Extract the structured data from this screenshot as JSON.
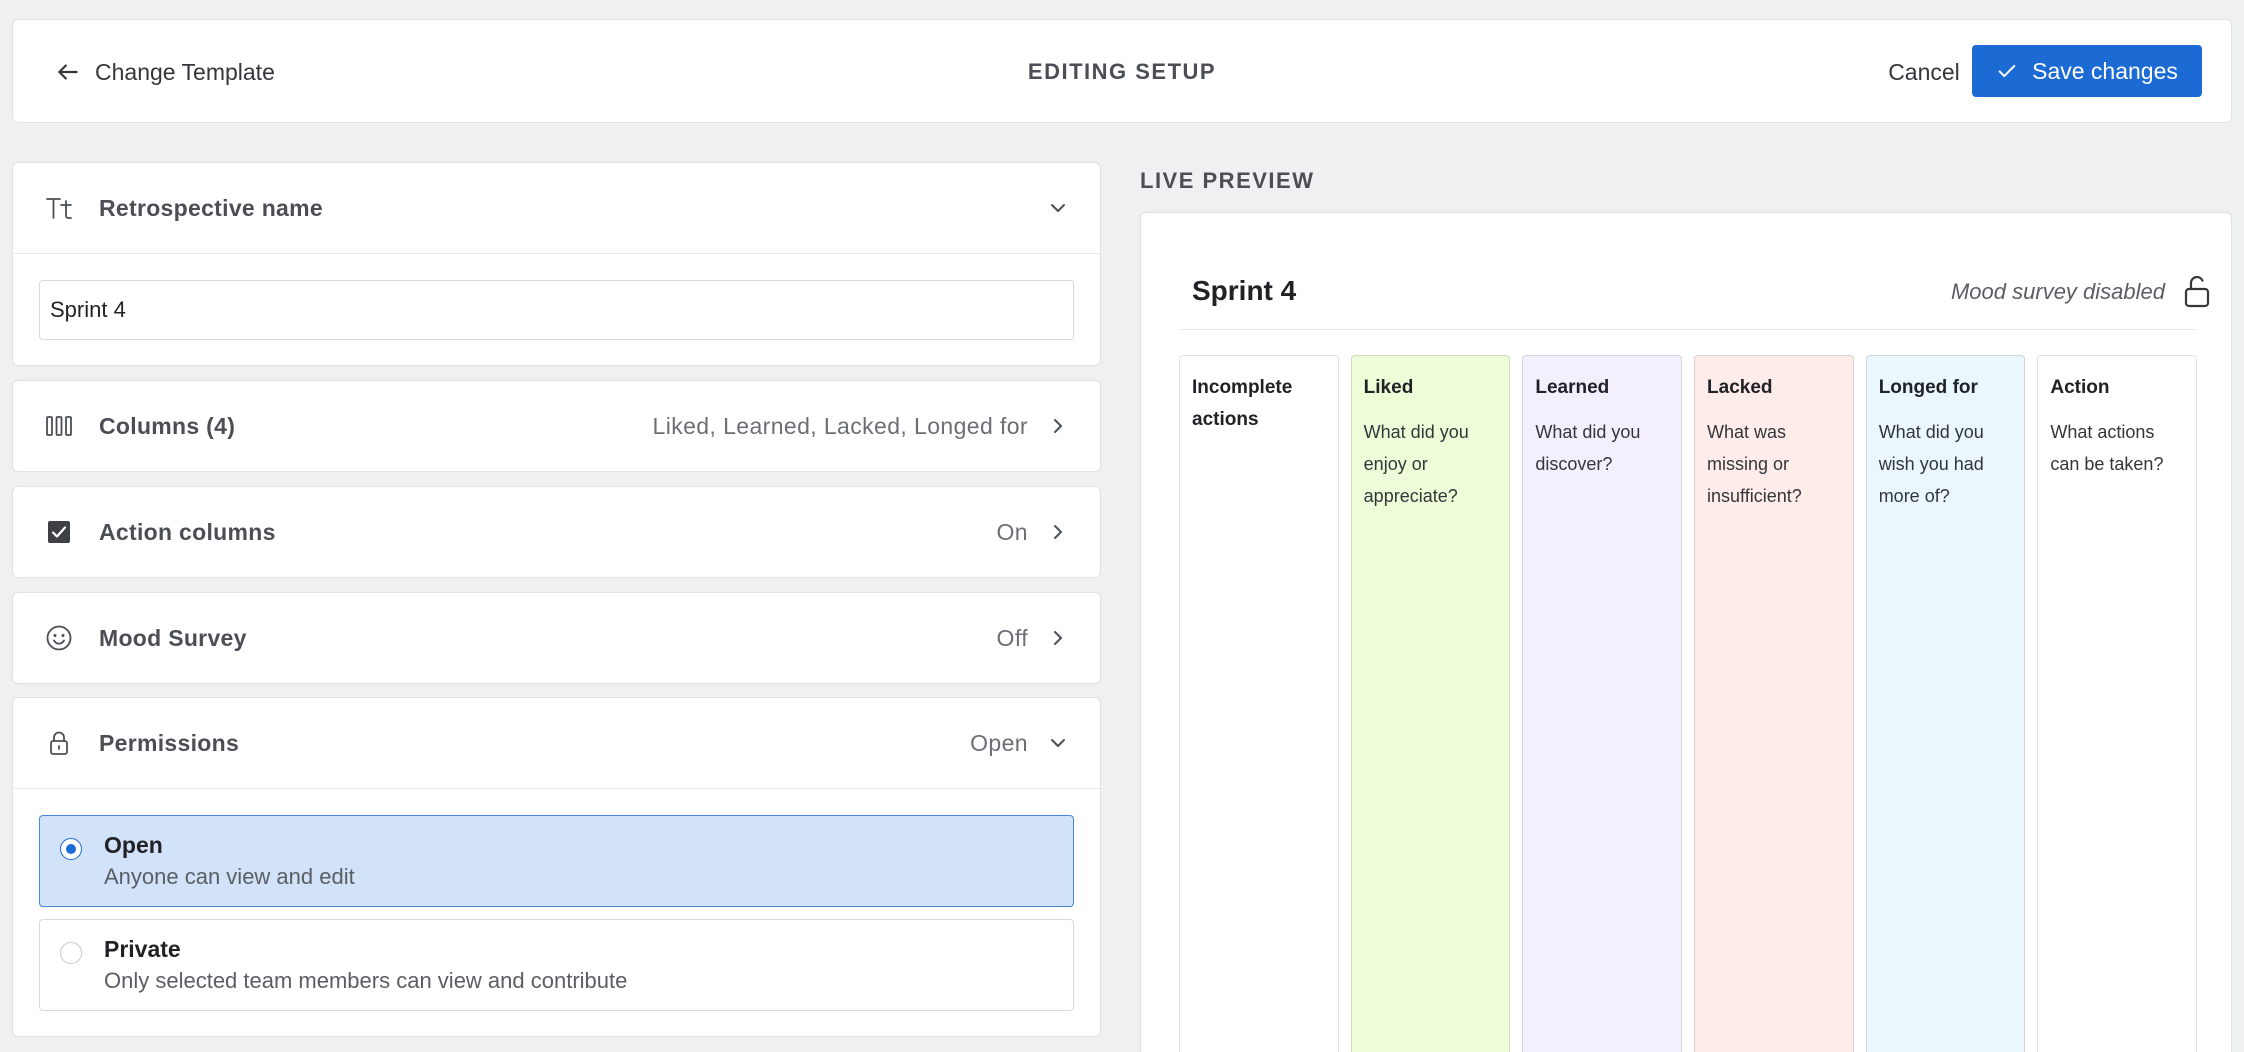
{
  "header": {
    "back_label": "Change Template",
    "title": "EDITING SETUP",
    "cancel_label": "Cancel",
    "save_label": "Save changes"
  },
  "settings": {
    "name_section": {
      "label": "Retrospective name",
      "value": "Sprint 4"
    },
    "columns": {
      "label": "Columns (4)",
      "value": "Liked, Learned, Lacked, Longed for"
    },
    "action_columns": {
      "label": "Action columns",
      "value": "On"
    },
    "mood_survey": {
      "label": "Mood Survey",
      "value": "Off"
    },
    "permissions": {
      "label": "Permissions",
      "value": "Open",
      "options": [
        {
          "title": "Open",
          "description": "Anyone can view and edit",
          "selected": true
        },
        {
          "title": "Private",
          "description": "Only selected team members can view and contribute",
          "selected": false
        }
      ]
    }
  },
  "preview": {
    "heading": "LIVE PREVIEW",
    "title": "Sprint 4",
    "mood_status": "Mood survey disabled",
    "columns": [
      {
        "title": "Incomplete actions",
        "description": "",
        "color": "#ffffff"
      },
      {
        "title": "Liked",
        "description": "What did you enjoy or appreciate?",
        "color": "#eefcd8"
      },
      {
        "title": "Learned",
        "description": "What did you discover?",
        "color": "#f3effd"
      },
      {
        "title": "Lacked",
        "description": "What was missing or insufficient?",
        "color": "#fdecea"
      },
      {
        "title": "Longed for",
        "description": "What did you wish you had more of?",
        "color": "#eaf7fd"
      },
      {
        "title": "Action",
        "description": "What actions can be taken?",
        "color": "#ffffff"
      }
    ]
  },
  "colors": {
    "accent": "#1c6ad3",
    "selected_bg": "#d2e2f9"
  }
}
